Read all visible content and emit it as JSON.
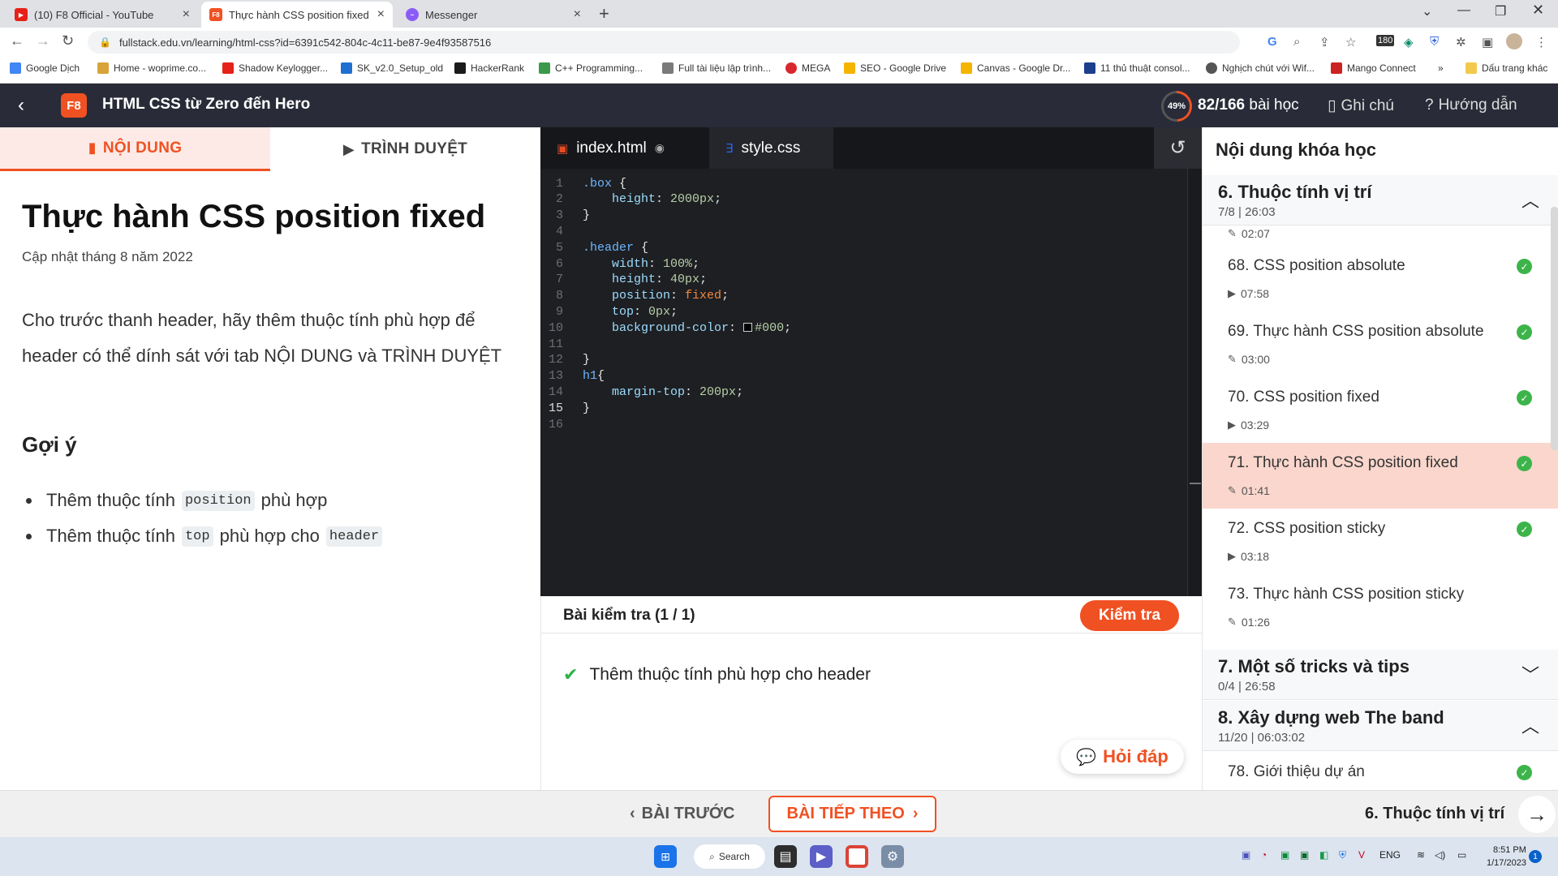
{
  "browser": {
    "tabs": [
      {
        "label": "(10) F8 Official - YouTube",
        "favicon": "youtube-icon",
        "active": false
      },
      {
        "label": "Thực hành CSS position fixed",
        "favicon": "f8-icon",
        "active": true
      },
      {
        "label": "Messenger",
        "favicon": "messenger-icon",
        "active": false
      }
    ],
    "url": "fullstack.edu.vn/learning/html-css?id=6391c542-804c-4c11-be87-9e4f93587516",
    "bookmarks": [
      "Google Dịch",
      "Home - woprime.co...",
      "Shadow Keylogger...",
      "SK_v2.0_Setup_old",
      "HackerRank",
      "C++ Programming...",
      "Full tài liệu lập trình...",
      "MEGA",
      "SEO - Google Drive",
      "Canvas - Google Dr...",
      "11 thủ thuật consol...",
      "Nghịch chút với Wif...",
      "Mango Connect",
      "»",
      "Dấu trang khác"
    ],
    "extension_badge": "180"
  },
  "app": {
    "logo": "F8",
    "course_title": "HTML CSS từ Zero đến Hero",
    "progress_percent": "49%",
    "progress_value": 0.49,
    "lessons_done": "82/166",
    "lessons_suffix": "bài học",
    "notes_label": "Ghi chú",
    "guide_label": "Hướng dẫn"
  },
  "left": {
    "tab_content": "NỘI DUNG",
    "tab_browser": "TRÌNH DUYỆT",
    "title": "Thực hành CSS position fixed",
    "updated": "Cập nhật tháng 8 năm 2022",
    "description": "Cho trước thanh header, hãy thêm thuộc tính phù hợp để header có thể dính sát với tab NỘI DUNG và TRÌNH DUYỆT",
    "hint_title": "Gợi ý",
    "hints": [
      {
        "before": "Thêm thuộc tính",
        "code": "position",
        "after": "phù hợp",
        "code2": ""
      },
      {
        "before": "Thêm thuộc tính",
        "code": "top",
        "after": "phù hợp cho",
        "code2": "header"
      }
    ]
  },
  "editor": {
    "tab_html": "index.html",
    "tab_css": "style.css",
    "current_line": 15,
    "lines": [
      ".box {",
      "    height: 2000px;",
      "}",
      "",
      ".header {",
      "    width: 100%;",
      "    height: 40px;",
      "    position: fixed;",
      "    top: 0px;",
      "    background-color: #000;",
      "",
      "}",
      "h1{",
      "    margin-top: 200px;",
      "}",
      ""
    ]
  },
  "test": {
    "title": "Bài kiểm tra (1 / 1)",
    "check_button": "Kiểm tra",
    "result": "Thêm thuộc tính phù hợp cho header",
    "qa_button": "Hỏi đáp"
  },
  "sidebar": {
    "title": "Nội dung khóa học",
    "sections": [
      {
        "title": "6. Thuộc tính vị trí",
        "meta": "7/8 | 26:03",
        "expanded": true
      },
      {
        "title": "7. Một số tricks và tips",
        "meta": "0/4 | 26:58",
        "expanded": false
      },
      {
        "title": "8. Xây dựng web The band",
        "meta": "11/20 | 06:03:02",
        "expanded": true
      }
    ],
    "partial_meta": "02:07",
    "lessons": [
      {
        "name": "68. CSS position absolute",
        "meta": "07:58",
        "type": "video",
        "done": true
      },
      {
        "name": "69. Thực hành CSS position absolute",
        "meta": "03:00",
        "type": "exercise",
        "done": true
      },
      {
        "name": "70. CSS position fixed",
        "meta": "03:29",
        "type": "video",
        "done": true
      },
      {
        "name": "71. Thực hành CSS position fixed",
        "meta": "01:41",
        "type": "exercise",
        "done": true,
        "active": true
      },
      {
        "name": "72. CSS position sticky",
        "meta": "03:18",
        "type": "video",
        "done": true
      },
      {
        "name": "73. Thực hành CSS position sticky",
        "meta": "01:26",
        "type": "exercise",
        "done": false
      }
    ],
    "next_section_lesson": {
      "name": "78. Giới thiệu dự án",
      "done": true
    }
  },
  "footer": {
    "prev": "BÀI TRƯỚC",
    "next": "BÀI TIẾP THEO",
    "chapter": "6. Thuộc tính vị trí"
  },
  "taskbar": {
    "search": "Search",
    "lang": "ENG",
    "time": "8:51 PM",
    "date": "1/17/2023",
    "notifications": "1"
  },
  "colors": {
    "accent": "#f05123",
    "header_bg": "#292b38",
    "editor_bg": "#1e1f22",
    "active_lesson_bg": "#fad6cc",
    "done_green": "#3cb44a"
  }
}
